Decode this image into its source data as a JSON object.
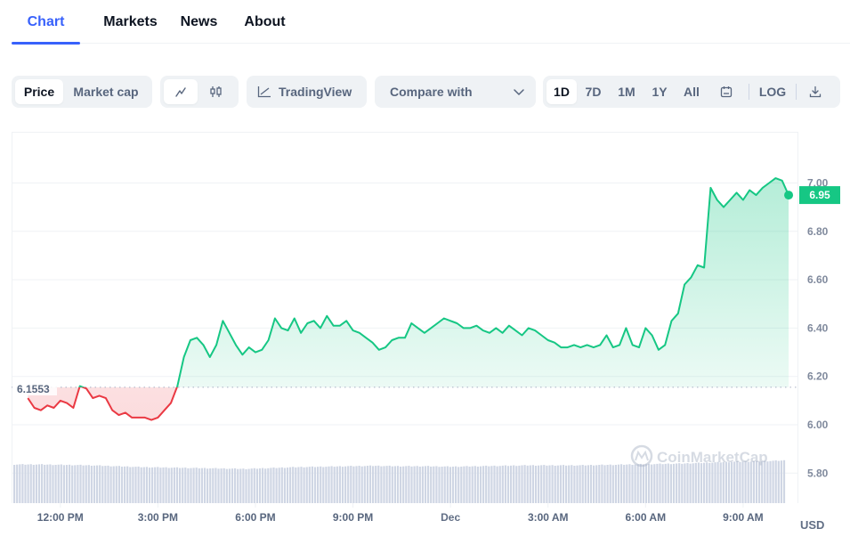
{
  "tabs": [
    {
      "label": "Chart",
      "active": true
    },
    {
      "label": "Markets",
      "active": false
    },
    {
      "label": "News",
      "active": false
    },
    {
      "label": "About",
      "active": false
    }
  ],
  "toolbar": {
    "metric_toggle": [
      {
        "label": "Price",
        "active": true
      },
      {
        "label": "Market cap",
        "active": false
      }
    ],
    "chart_style": [
      {
        "icon": "line-chart-icon",
        "active": true
      },
      {
        "icon": "candlestick-icon",
        "active": false
      }
    ],
    "tradingview_label": "TradingView",
    "compare_label": "Compare with",
    "ranges": [
      {
        "label": "1D",
        "active": true
      },
      {
        "label": "7D",
        "active": false
      },
      {
        "label": "1M",
        "active": false
      },
      {
        "label": "1Y",
        "active": false
      },
      {
        "label": "All",
        "active": false
      }
    ],
    "log_label": "LOG"
  },
  "colors": {
    "up": "#16c784",
    "down": "#ea3943",
    "accent": "#3861fb",
    "volume": "#cfd6e4",
    "price_badge": "#16c784"
  },
  "chart_data": {
    "type": "line",
    "title": "",
    "xlabel": "",
    "ylabel": "USD",
    "currency": "USD",
    "ylim": [
      5.7,
      7.15
    ],
    "yticks": [
      5.8,
      6.0,
      6.2,
      6.4,
      6.6,
      6.8,
      7.0
    ],
    "ytick_labels": [
      "5.80",
      "6.00",
      "6.20",
      "6.40",
      "6.60",
      "6.80",
      "7.00"
    ],
    "xticks": [
      "12:00 PM",
      "3:00 PM",
      "6:00 PM",
      "9:00 PM",
      "Dec",
      "3:00 AM",
      "6:00 AM",
      "9:00 AM"
    ],
    "xtick_positions_hours": [
      1.5,
      4.5,
      7.5,
      10.5,
      13.5,
      16.5,
      19.5,
      22.5
    ],
    "x_range_hours": [
      0,
      24.2
    ],
    "baseline": 6.1553,
    "baseline_label": "6.1553",
    "current_price": 6.95,
    "current_price_label": "6.95",
    "grid": true,
    "watermark": "CoinMarketCap",
    "series": [
      {
        "name": "Price",
        "x_hours": [
          0.5,
          0.7,
          0.9,
          1.1,
          1.3,
          1.5,
          1.7,
          1.9,
          2.1,
          2.3,
          2.5,
          2.7,
          2.9,
          3.1,
          3.3,
          3.5,
          3.7,
          3.9,
          4.1,
          4.3,
          4.5,
          4.7,
          4.9,
          5.1,
          5.3,
          5.5,
          5.7,
          5.9,
          6.1,
          6.3,
          6.5,
          6.7,
          6.9,
          7.1,
          7.3,
          7.5,
          7.7,
          7.9,
          8.1,
          8.3,
          8.5,
          8.7,
          8.9,
          9.1,
          9.3,
          9.5,
          9.7,
          9.9,
          10.1,
          10.3,
          10.5,
          10.7,
          10.9,
          11.1,
          11.3,
          11.5,
          11.7,
          11.9,
          12.1,
          12.3,
          12.5,
          12.7,
          12.9,
          13.1,
          13.3,
          13.5,
          13.7,
          13.9,
          14.1,
          14.3,
          14.5,
          14.7,
          14.9,
          15.1,
          15.3,
          15.5,
          15.7,
          15.9,
          16.1,
          16.3,
          16.5,
          16.7,
          16.9,
          17.1,
          17.3,
          17.5,
          17.7,
          17.9,
          18.1,
          18.3,
          18.5,
          18.7,
          18.9,
          19.1,
          19.3,
          19.5,
          19.7,
          19.9,
          20.1,
          20.3,
          20.5,
          20.7,
          20.9,
          21.1,
          21.3,
          21.5,
          21.7,
          21.9,
          22.1,
          22.3,
          22.5,
          22.7,
          22.9,
          23.1,
          23.3,
          23.5,
          23.7,
          23.9
        ],
        "values": [
          6.11,
          6.07,
          6.06,
          6.08,
          6.07,
          6.1,
          6.09,
          6.07,
          6.16,
          6.15,
          6.11,
          6.12,
          6.11,
          6.06,
          6.04,
          6.05,
          6.03,
          6.03,
          6.03,
          6.02,
          6.03,
          6.06,
          6.09,
          6.16,
          6.28,
          6.35,
          6.36,
          6.33,
          6.28,
          6.33,
          6.43,
          6.38,
          6.33,
          6.29,
          6.32,
          6.3,
          6.31,
          6.35,
          6.44,
          6.4,
          6.39,
          6.44,
          6.38,
          6.42,
          6.43,
          6.4,
          6.45,
          6.41,
          6.41,
          6.43,
          6.39,
          6.38,
          6.36,
          6.34,
          6.31,
          6.32,
          6.35,
          6.36,
          6.36,
          6.42,
          6.4,
          6.38,
          6.4,
          6.42,
          6.44,
          6.43,
          6.42,
          6.4,
          6.4,
          6.41,
          6.39,
          6.38,
          6.4,
          6.38,
          6.41,
          6.39,
          6.37,
          6.4,
          6.39,
          6.37,
          6.35,
          6.34,
          6.32,
          6.32,
          6.33,
          6.32,
          6.33,
          6.32,
          6.33,
          6.37,
          6.32,
          6.33,
          6.4,
          6.33,
          6.32,
          6.4,
          6.37,
          6.31,
          6.33,
          6.43,
          6.46,
          6.58,
          6.61,
          6.66,
          6.65,
          6.98,
          6.93,
          6.9,
          6.93,
          6.96,
          6.93,
          6.97,
          6.95,
          6.98,
          7.0,
          7.02,
          7.01,
          6.95
        ]
      },
      {
        "name": "Volume",
        "type": "bar",
        "relative_levels": [
          0.86,
          0.86,
          0.85,
          0.84,
          0.82,
          0.8,
          0.79,
          0.78,
          0.77,
          0.76,
          0.78,
          0.8,
          0.81,
          0.82,
          0.83,
          0.82,
          0.82,
          0.81,
          0.82,
          0.83,
          0.84,
          0.84,
          0.84,
          0.85,
          0.86,
          0.87,
          0.88,
          0.9,
          0.92,
          0.93,
          0.95
        ]
      }
    ]
  }
}
